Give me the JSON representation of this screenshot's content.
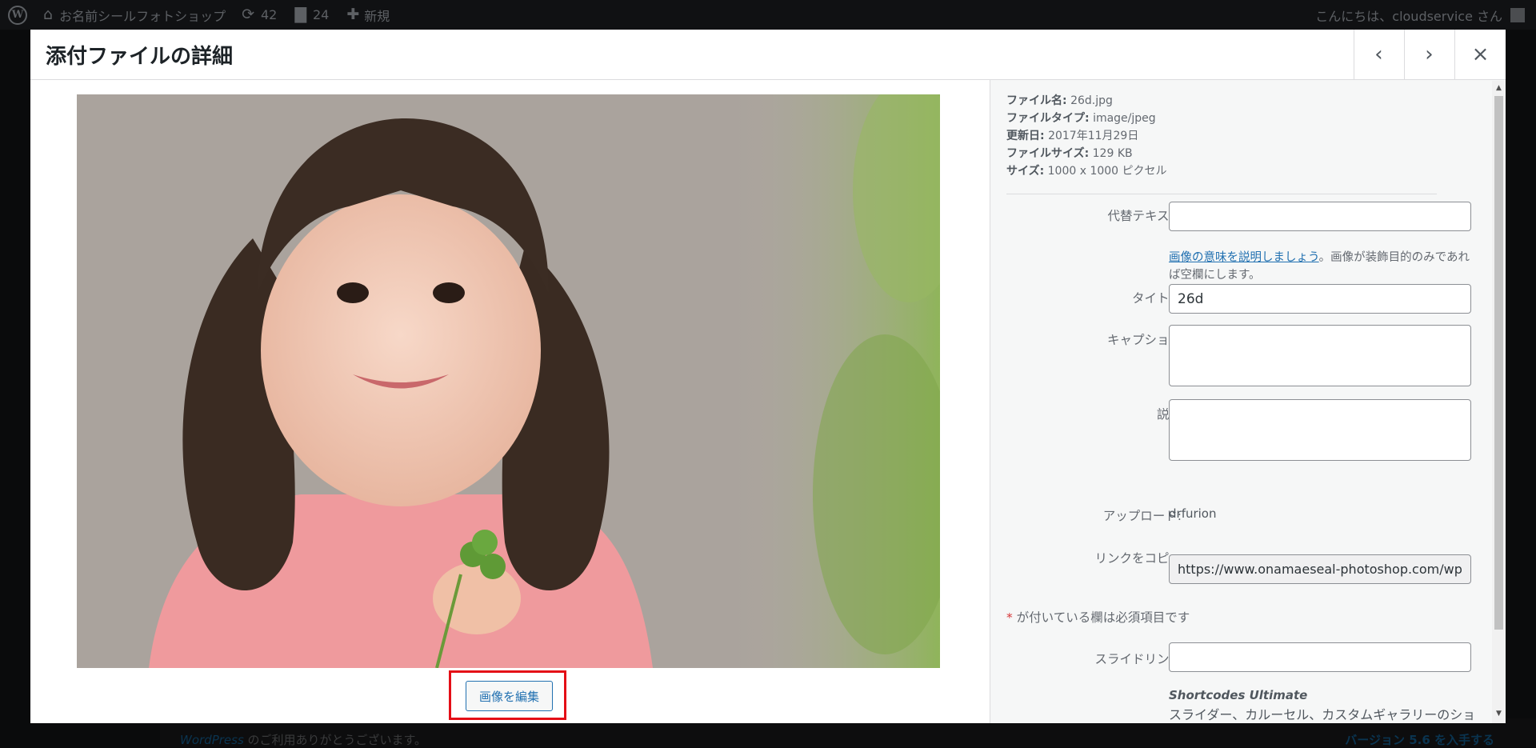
{
  "admin_bar": {
    "site_name": "お名前シールフォトショップ",
    "updates_count": "42",
    "comments_count": "24",
    "new_label": "新規",
    "greeting": "こんにちは、cloudservice さん"
  },
  "background_page": {
    "thanks_link": "WordPress",
    "thanks_text": " のご利用ありがとうございます。",
    "version_text": "バージョン 5.6 を入手する"
  },
  "modal": {
    "title": "添付ファイルの詳細",
    "prev_icon": "‹",
    "next_icon": "›",
    "close_icon": "×",
    "edit_image_button": "画像を編集"
  },
  "details": {
    "file_name_label": "ファイル名:",
    "file_name": "26d.jpg",
    "file_type_label": "ファイルタイプ:",
    "file_type": "image/jpeg",
    "uploaded_on_label": "更新日:",
    "uploaded_on": "2017年11月29日",
    "file_size_label": "ファイルサイズ:",
    "file_size": "129 KB",
    "dimensions_label": "サイズ:",
    "dimensions": "1000 x 1000 ピクセル",
    "alt_text_label": "代替テキスト",
    "alt_text_value": "",
    "alt_help_link": "画像の意味を説明しましょう",
    "alt_help_text": "。画像が装飾目的のみであれば空欄にします。",
    "title_label": "タイトル",
    "title_value": "26d",
    "caption_label": "キャプション",
    "caption_value": "",
    "description_label": "説明",
    "description_value": "",
    "uploaded_by_label": "アップロード:",
    "uploaded_by": "drfurion",
    "copy_link_label": "リンクをコピー",
    "copy_link_value": "https://www.onamaeseal-photoshop.com/wp-",
    "required_star": "*",
    "required_note": " が付いている欄は必須項目です",
    "slide_link_label": "スライドリンク",
    "slide_link_value": "",
    "shortcodes_title": "Shortcodes Ultimate",
    "shortcodes_desc": "スライダー、カルーセル、カスタムギャラリーのショートコードでスライドにカスタムリンクを追加するには、このフィールドを使用します"
  },
  "colors": {
    "accent": "#2271b1",
    "highlight_box": "#e40e16",
    "admin_bar_bg": "#101113"
  }
}
